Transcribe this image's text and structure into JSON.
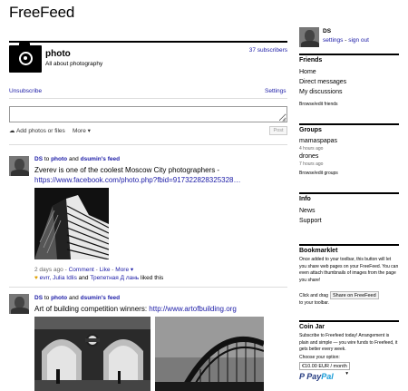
{
  "app": {
    "title": "FreeFeed"
  },
  "feed": {
    "name": "photo",
    "description": "All about photography",
    "subscribers": "37 subscribers",
    "unsubscribe": "Unsubscribe",
    "settings": "Settings"
  },
  "composer": {
    "placeholder": "",
    "attach": "Add photos or files",
    "more": "More ▾",
    "post": "Post"
  },
  "posts": [
    {
      "author": "DS",
      "to_word": "to",
      "feed": "photo",
      "and_word": "and",
      "feed2": "dsumin's feed",
      "text": "Zverev is one of the coolest Moscow City photographers -",
      "link": "https://www.facebook.com/photo.php?fbid=917322828325328…",
      "time": "2 days ago",
      "dash": " - ",
      "comment": "Comment",
      "dot": " - ",
      "like": "Like",
      "dot2": " - ",
      "more": "More ▾",
      "likes": "evrr, Julia Idlis",
      "likes_and": "and",
      "likes2": "Трепетная Д лань",
      "likes_tail": "liked this"
    },
    {
      "author": "DS",
      "to_word": "to",
      "feed": "photo",
      "and_word": "and",
      "feed2": "dsumin's feed",
      "text": "Art of building competition winners:",
      "link": "http://www.artofbuilding.org"
    }
  ],
  "sidebar": {
    "user": "DS",
    "settings": "settings",
    "sep": " - ",
    "signout": "sign out",
    "friends": {
      "title": "Friends",
      "items": [
        "Home",
        "Direct messages",
        "My discussions"
      ],
      "edit": "Browse/edit friends"
    },
    "groups": {
      "title": "Groups",
      "items": [
        {
          "name": "mamaspapas",
          "time": "4 hours ago"
        },
        {
          "name": "drones",
          "time": "7 hours ago"
        }
      ],
      "edit": "Browse/edit groups"
    },
    "info": {
      "title": "Info",
      "items": [
        "News",
        "Support"
      ]
    },
    "bookmarklet": {
      "title": "Bookmarklet",
      "text": "Once added to your toolbar, this button will let you share web pages on your FreeFeed. You can even attach thumbnails of images from the page you share!",
      "drag": "Click and drag",
      "button": "Share on FreeFeed",
      "drag2": "to your toolbar."
    },
    "coinjar": {
      "title": "Coin Jar",
      "text": "Subscribe to Freefeed today! Arrangement is plain and simple — you wire funds to Freefeed, it gets better every week.",
      "choose": "Choose your option:",
      "option": "€10.00 EUR / month",
      "paypal_pay": "Pay",
      "paypal_pal": "Pal"
    }
  },
  "colors": {
    "link": "#1a1aa6",
    "paypal_dark": "#253b80",
    "paypal_light": "#179bd7"
  }
}
